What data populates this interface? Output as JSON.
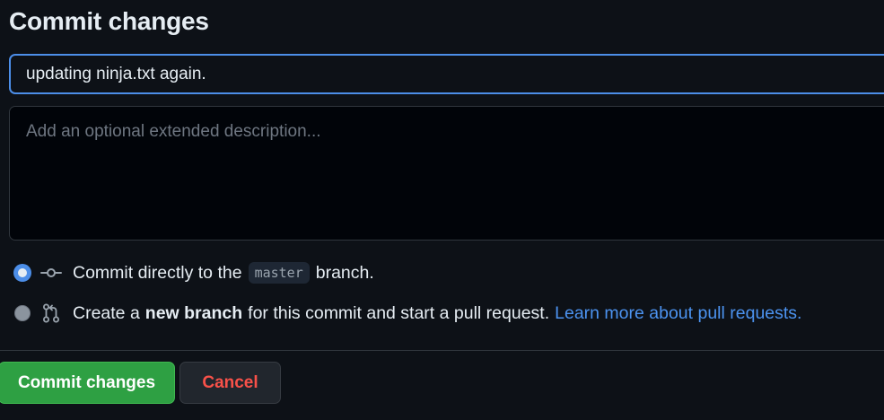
{
  "form": {
    "title": "Commit changes",
    "summary_value": "updating ninja.txt again.",
    "description_placeholder": "Add an optional extended description..."
  },
  "options": {
    "direct": {
      "text_before": "Commit directly to the",
      "branch": "master",
      "text_after": "branch.",
      "selected": true,
      "icon": "git-commit-icon"
    },
    "new_branch": {
      "text_before": "Create a",
      "bold": "new branch",
      "text_after": "for this commit and start a pull request.",
      "link": "Learn more about pull requests.",
      "selected": false,
      "icon": "git-pull-request-icon"
    }
  },
  "buttons": {
    "commit_label": "Commit changes",
    "cancel_label": "Cancel"
  },
  "colors": {
    "background": "#0d1117",
    "accent_blue": "#4c8ee8",
    "commit_green": "#2ea043",
    "cancel_red": "#f85149",
    "link_blue": "#4c93f0"
  }
}
